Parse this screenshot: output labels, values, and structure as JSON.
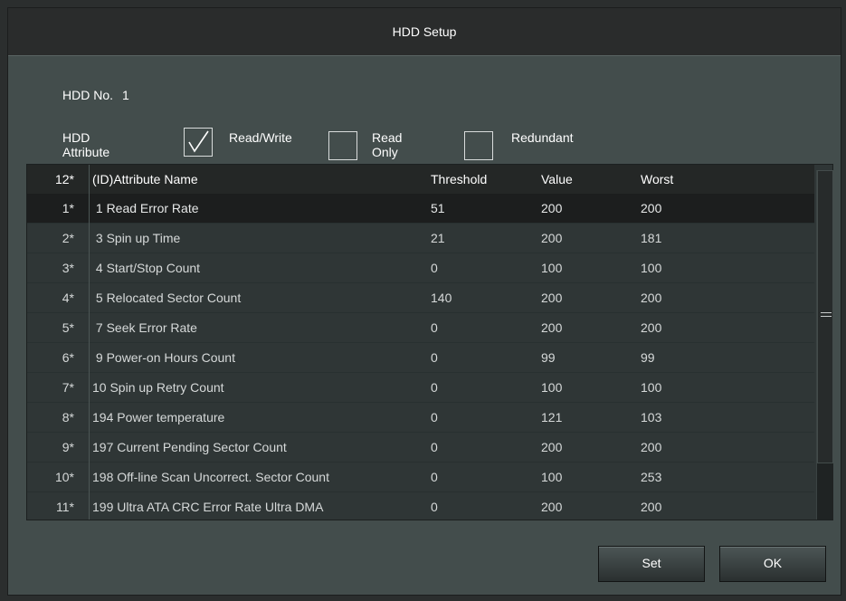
{
  "window": {
    "title": "HDD Setup"
  },
  "hdd": {
    "label": "HDD No.",
    "number": "1"
  },
  "attribute": {
    "label": "HDD Attribute",
    "options": [
      {
        "label": "Read/Write",
        "checked": true
      },
      {
        "label": "Read Only",
        "checked": false
      },
      {
        "label": "Redundant",
        "checked": false
      }
    ]
  },
  "table": {
    "columns": {
      "no": "12*",
      "name": "(ID)Attribute Name",
      "threshold": "Threshold",
      "value": "Value",
      "worst": "Worst"
    },
    "rows": [
      {
        "no": "1*",
        "name": " 1 Read Error Rate",
        "threshold": "51",
        "value": "200",
        "worst": "200"
      },
      {
        "no": "2*",
        "name": " 3 Spin up Time",
        "threshold": "21",
        "value": "200",
        "worst": "181"
      },
      {
        "no": "3*",
        "name": " 4 Start/Stop Count",
        "threshold": "0",
        "value": "100",
        "worst": "100"
      },
      {
        "no": "4*",
        "name": " 5 Relocated Sector Count",
        "threshold": "140",
        "value": "200",
        "worst": "200"
      },
      {
        "no": "5*",
        "name": " 7 Seek Error Rate",
        "threshold": "0",
        "value": "200",
        "worst": "200"
      },
      {
        "no": "6*",
        "name": " 9 Power-on Hours Count",
        "threshold": "0",
        "value": "99",
        "worst": "99"
      },
      {
        "no": "7*",
        "name": "10 Spin up Retry Count",
        "threshold": "0",
        "value": "100",
        "worst": "100"
      },
      {
        "no": "8*",
        "name": "194 Power temperature",
        "threshold": "0",
        "value": "121",
        "worst": "103"
      },
      {
        "no": "9*",
        "name": "197 Current Pending Sector Count",
        "threshold": "0",
        "value": "200",
        "worst": "200"
      },
      {
        "no": "10*",
        "name": "198 Off-line Scan Uncorrect. Sector Count",
        "threshold": "0",
        "value": "100",
        "worst": "253"
      },
      {
        "no": "11*",
        "name": "199 Ultra ATA CRC Error Rate Ultra DMA",
        "threshold": "0",
        "value": "200",
        "worst": "200"
      }
    ]
  },
  "buttons": {
    "set": "Set",
    "ok": "OK"
  }
}
